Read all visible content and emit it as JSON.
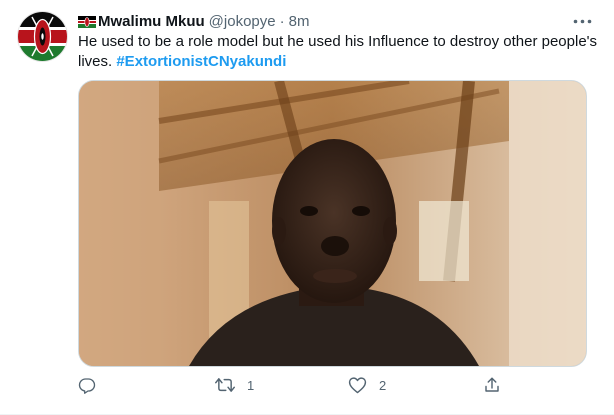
{
  "tweet": {
    "author_name": "Mwalimu Mkuu",
    "handle": "@jokopye",
    "separator": "·",
    "time": "8m",
    "text_before_hashtag": "He used to be a role model but he used his Influence to destroy other people's lives. ",
    "hashtag": "#ExtortionistCNyakundi",
    "media_description": "selfie photo of a man indoors",
    "actions": {
      "reply_count": "",
      "retweet_count": "1",
      "like_count": "2",
      "share_count": ""
    }
  },
  "icons": {
    "avatar": "kenya-flag-shield-avatar",
    "name_badge": "kenya-flag-icon",
    "more": "more-icon",
    "reply": "reply-icon",
    "retweet": "retweet-icon",
    "like": "heart-icon",
    "share": "share-icon"
  },
  "colors": {
    "link": "#1d9bf0",
    "muted": "#536471",
    "text": "#0f1419"
  }
}
